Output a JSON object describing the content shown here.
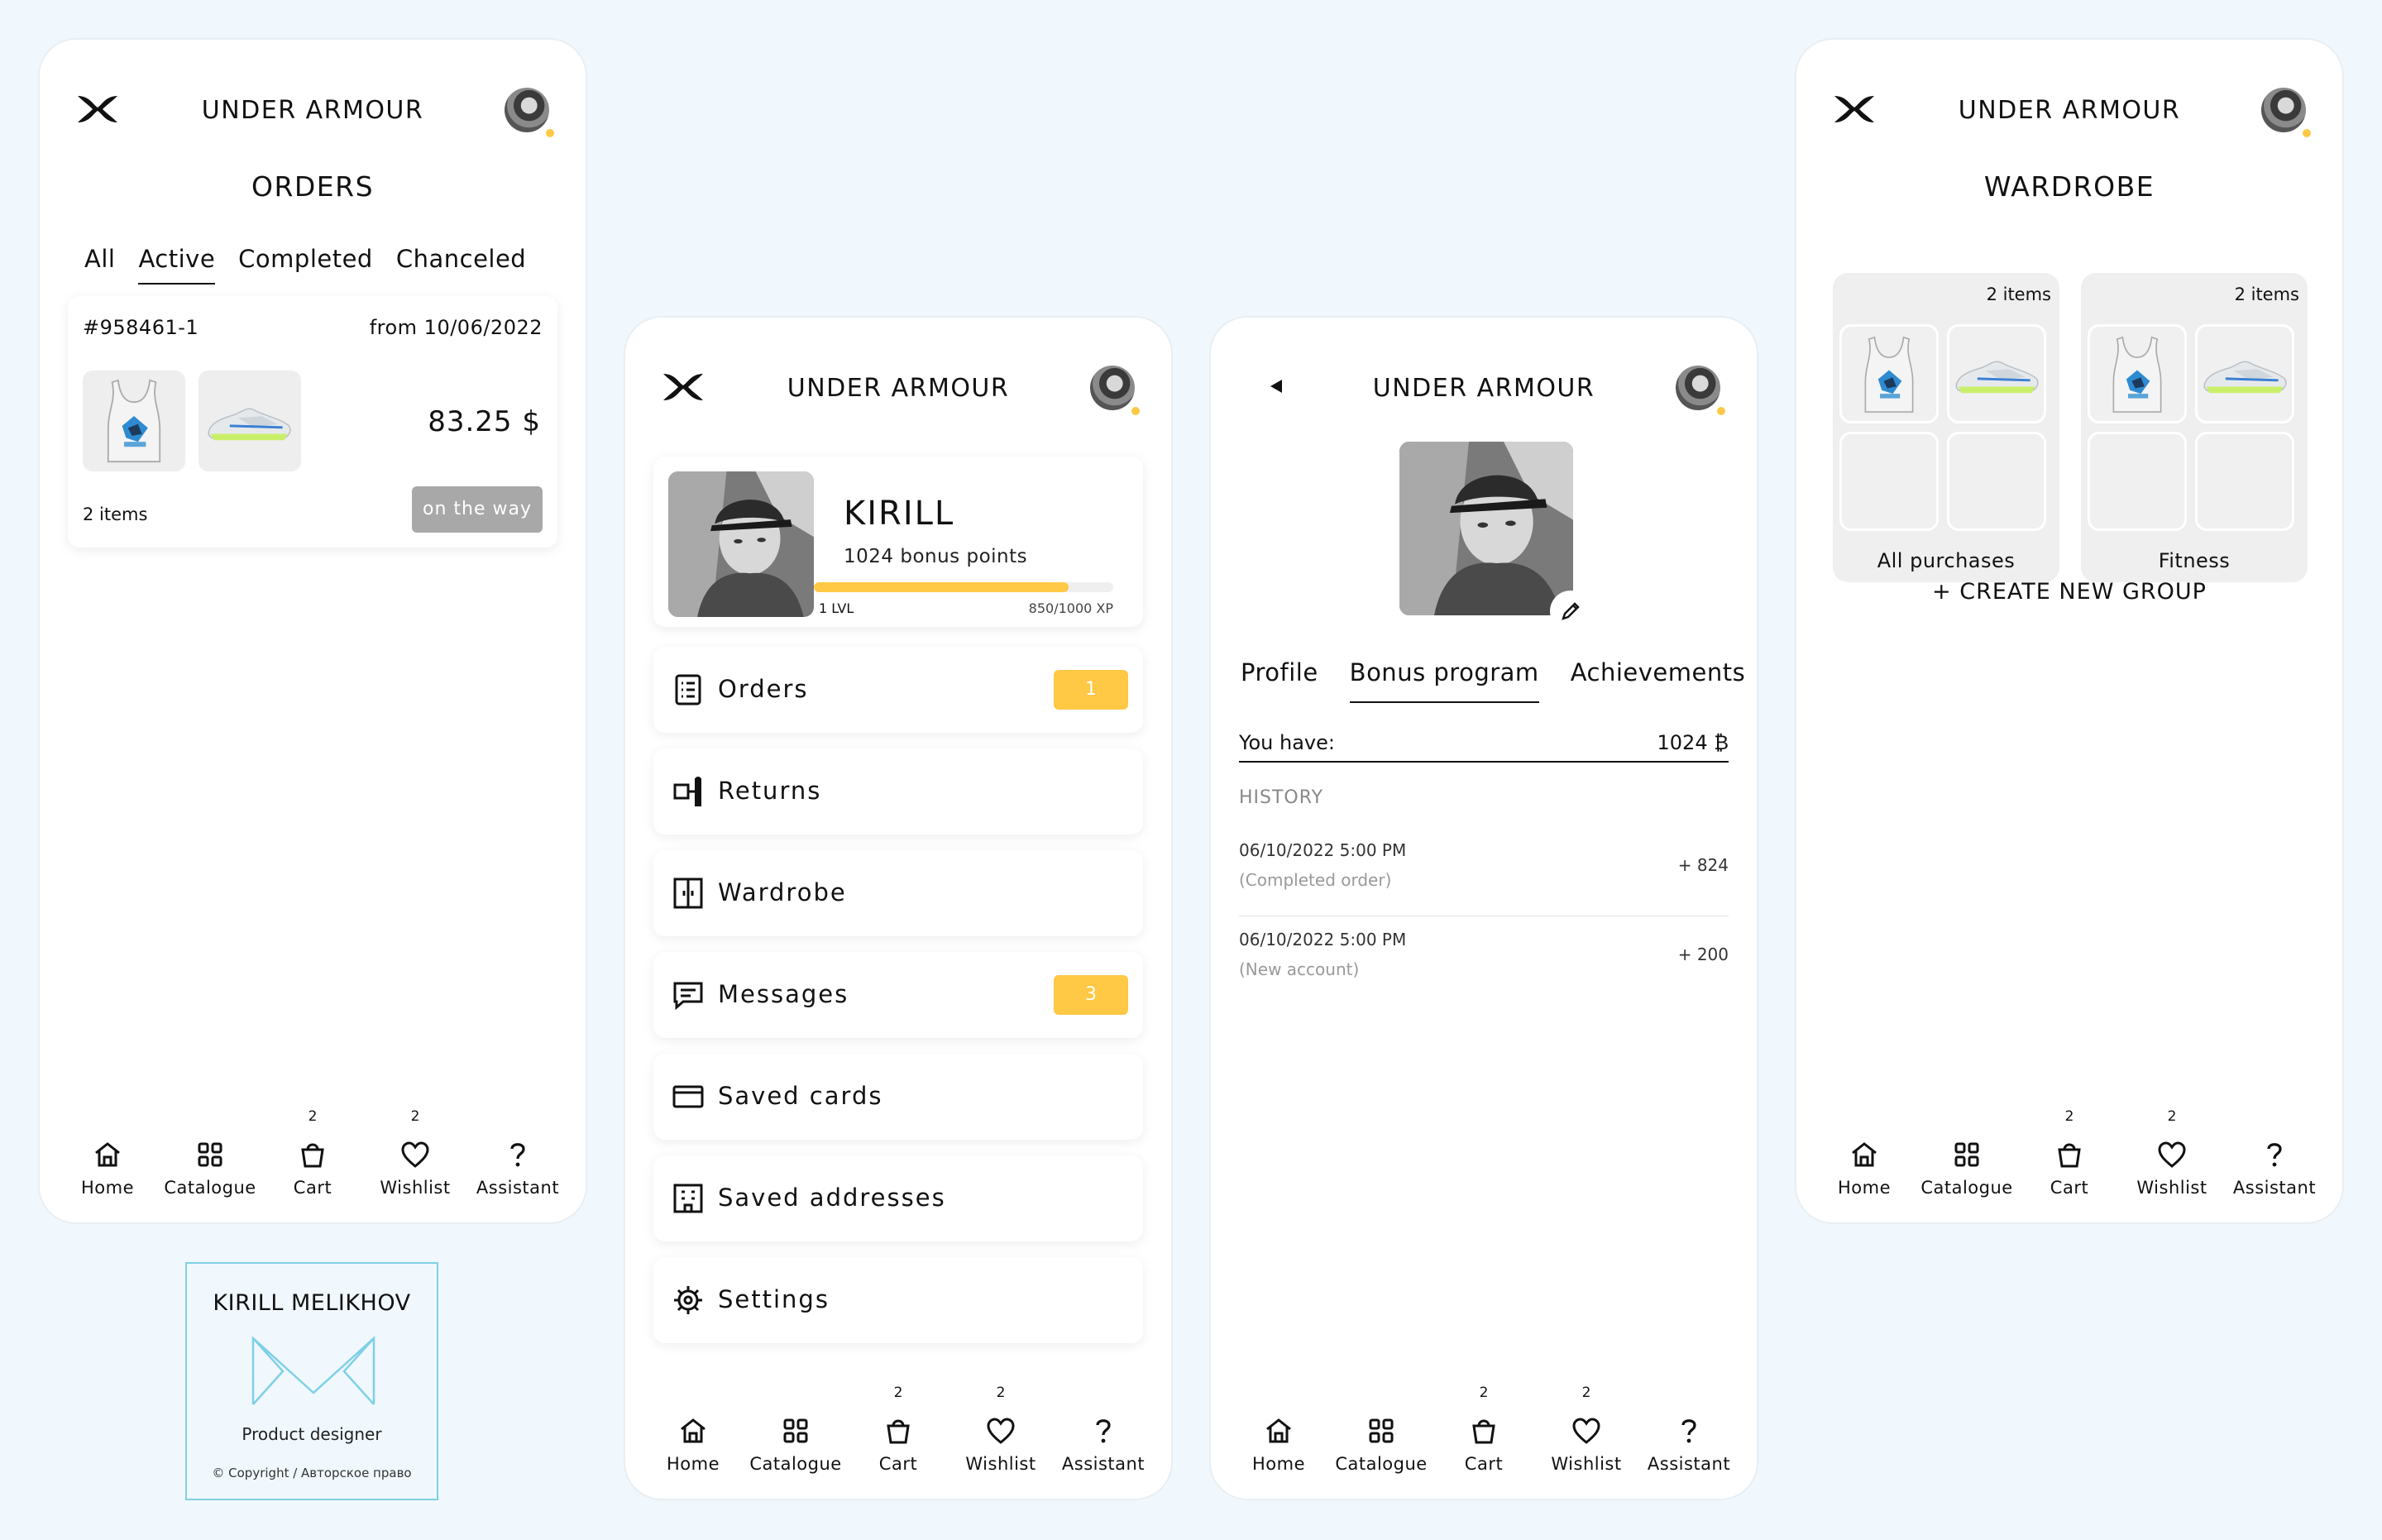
{
  "brand": "UNDER ARMOUR",
  "bottom_nav": {
    "home": "Home",
    "catalogue": "Catalogue",
    "cart": "Cart",
    "cart_count": "2",
    "wishlist": "Wishlist",
    "wishlist_count": "2",
    "assistant": "Assistant"
  },
  "orders_screen": {
    "title": "ORDERS",
    "tabs": [
      "All",
      "Active",
      "Completed",
      "Chanceled"
    ],
    "active_tab": "Active",
    "order": {
      "id": "#958461-1",
      "date": "from 10/06/2022",
      "price": "83.25 $",
      "items": "2 items",
      "status": "on the way"
    }
  },
  "profile_menu_screen": {
    "name": "KIRILL",
    "bonus": "1024 bonus points",
    "level": "1 LVL",
    "xp": "850/1000 XP",
    "xp_progress": 0.85,
    "menu": [
      {
        "label": "Orders",
        "badge": "1",
        "icon": "orders-icon"
      },
      {
        "label": "Returns",
        "badge": "",
        "icon": "returns-icon"
      },
      {
        "label": "Wardrobe",
        "badge": "",
        "icon": "wardrobe-icon"
      },
      {
        "label": "Messages",
        "badge": "3",
        "icon": "messages-icon"
      },
      {
        "label": "Saved cards",
        "badge": "",
        "icon": "card-icon"
      },
      {
        "label": "Saved addresses",
        "badge": "",
        "icon": "address-icon"
      },
      {
        "label": "Settings",
        "badge": "",
        "icon": "gear-icon"
      }
    ]
  },
  "bonus_screen": {
    "tabs": [
      "Profile",
      "Bonus program",
      "Achievements"
    ],
    "active_tab": "Bonus program",
    "you_have_label": "You have:",
    "you_have_value": "1024 ₿",
    "history_title": "HISTORY",
    "history": [
      {
        "date": "06/10/2022  5:00 PM",
        "sub": "(Completed order)",
        "amount": "+ 824"
      },
      {
        "date": "06/10/2022  5:00 PM",
        "sub": "(New account)",
        "amount": "+ 200"
      }
    ]
  },
  "wardrobe_screen": {
    "title": "WARDROBE",
    "groups": [
      {
        "name": "All purchases",
        "count": "2 items"
      },
      {
        "name": "Fitness",
        "count": "2 items"
      }
    ],
    "create_group": "+ CREATE NEW GROUP"
  },
  "signature": {
    "name": "KIRILL MELIKHOV",
    "role": "Product designer",
    "copyright": "© Copyright / Авторское право"
  },
  "colors": {
    "accent": "#ffc845",
    "status_gray": "#a8a8a8",
    "background": "#f0f8fd"
  }
}
